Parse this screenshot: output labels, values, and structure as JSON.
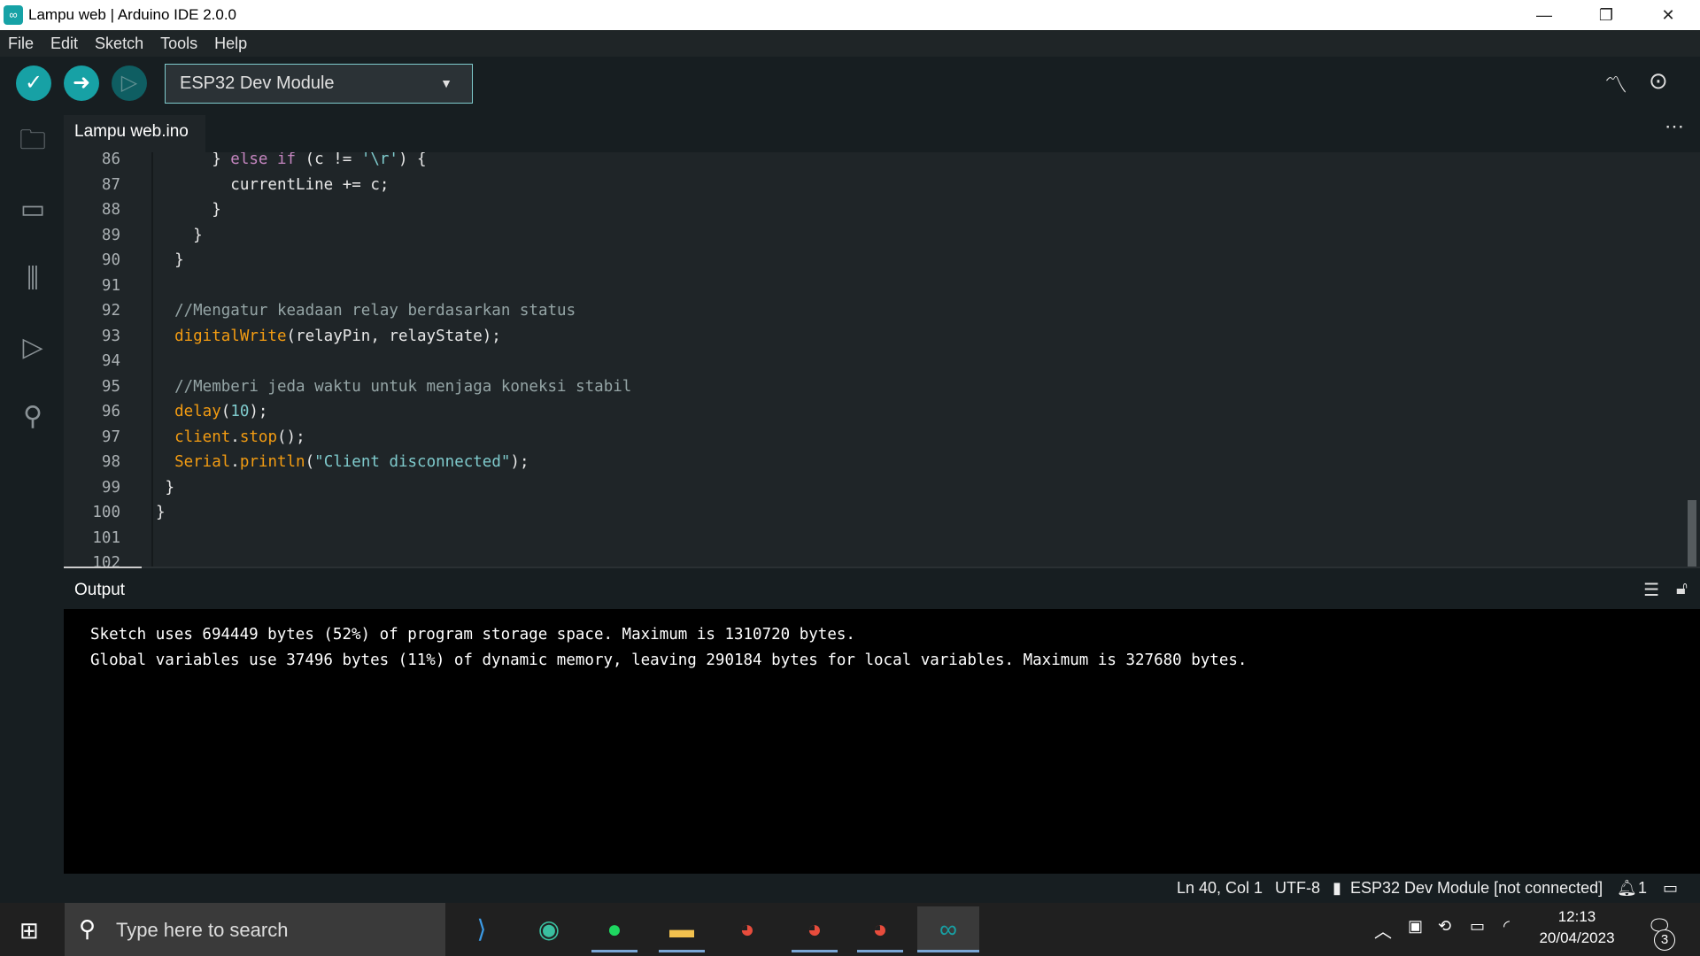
{
  "window": {
    "title": "Lampu web | Arduino IDE 2.0.0"
  },
  "menu": [
    "File",
    "Edit",
    "Sketch",
    "Tools",
    "Help"
  ],
  "toolbar": {
    "board": "ESP32 Dev Module"
  },
  "tab": {
    "label": "Lampu web.ino"
  },
  "editor": {
    "lines": [
      {
        "n": "86",
        "html": "<span>      } </span><span class='kw'>else if</span><span> (c != </span><span class='str'>'\\r'</span><span>) {</span>"
      },
      {
        "n": "87",
        "text": "        currentLine += c;"
      },
      {
        "n": "88",
        "text": "      }"
      },
      {
        "n": "89",
        "text": "    }"
      },
      {
        "n": "90",
        "text": "  }"
      },
      {
        "n": "91",
        "text": ""
      },
      {
        "n": "92",
        "text": "  //Mengatur keadaan relay berdasarkan status",
        "cls": "cm"
      },
      {
        "n": "93",
        "parts": [
          [
            "  ",
            ""
          ],
          [
            "digitalWrite",
            "fn"
          ],
          [
            "(relayPin, relayState);",
            ""
          ]
        ]
      },
      {
        "n": "94",
        "text": ""
      },
      {
        "n": "95",
        "text": "  //Memberi jeda waktu untuk menjaga koneksi stabil",
        "cls": "cm"
      },
      {
        "n": "96",
        "parts": [
          [
            "  ",
            ""
          ],
          [
            "delay",
            "fn"
          ],
          [
            "(",
            ""
          ],
          [
            "10",
            "num"
          ],
          [
            ");",
            ""
          ]
        ]
      },
      {
        "n": "97",
        "parts": [
          [
            "  ",
            ""
          ],
          [
            "client",
            "fn"
          ],
          [
            ".",
            ""
          ],
          [
            "stop",
            "fn"
          ],
          [
            "();",
            ""
          ]
        ]
      },
      {
        "n": "98",
        "parts": [
          [
            "  ",
            ""
          ],
          [
            "Serial",
            "fn"
          ],
          [
            ".",
            ""
          ],
          [
            "println",
            "fn"
          ],
          [
            "(",
            ""
          ],
          [
            "\"Client disconnected\"",
            "str"
          ],
          [
            ");",
            ""
          ]
        ]
      },
      {
        "n": "99",
        "text": " }"
      },
      {
        "n": "100",
        "text": "}"
      },
      {
        "n": "101",
        "text": ""
      },
      {
        "n": "102",
        "text": ""
      }
    ]
  },
  "output": {
    "title": "Output",
    "lines": [
      "Sketch uses 694449 bytes (52%) of program storage space. Maximum is 1310720 bytes.",
      "Global variables use 37496 bytes (11%) of dynamic memory, leaving 290184 bytes for local variables. Maximum is 327680 bytes."
    ]
  },
  "status": {
    "position": "Ln 40, Col 1",
    "encoding": "UTF-8",
    "board": "ESP32 Dev Module [not connected]",
    "notifications": "1"
  },
  "taskbar": {
    "search_placeholder": "Type here to search",
    "time": "12:13",
    "date": "20/04/2023",
    "notif_count": "3"
  },
  "colors": {
    "accent": "#17a1a5",
    "function": "#f39c12",
    "string": "#7fcbcd",
    "comment": "#95a5a6"
  }
}
